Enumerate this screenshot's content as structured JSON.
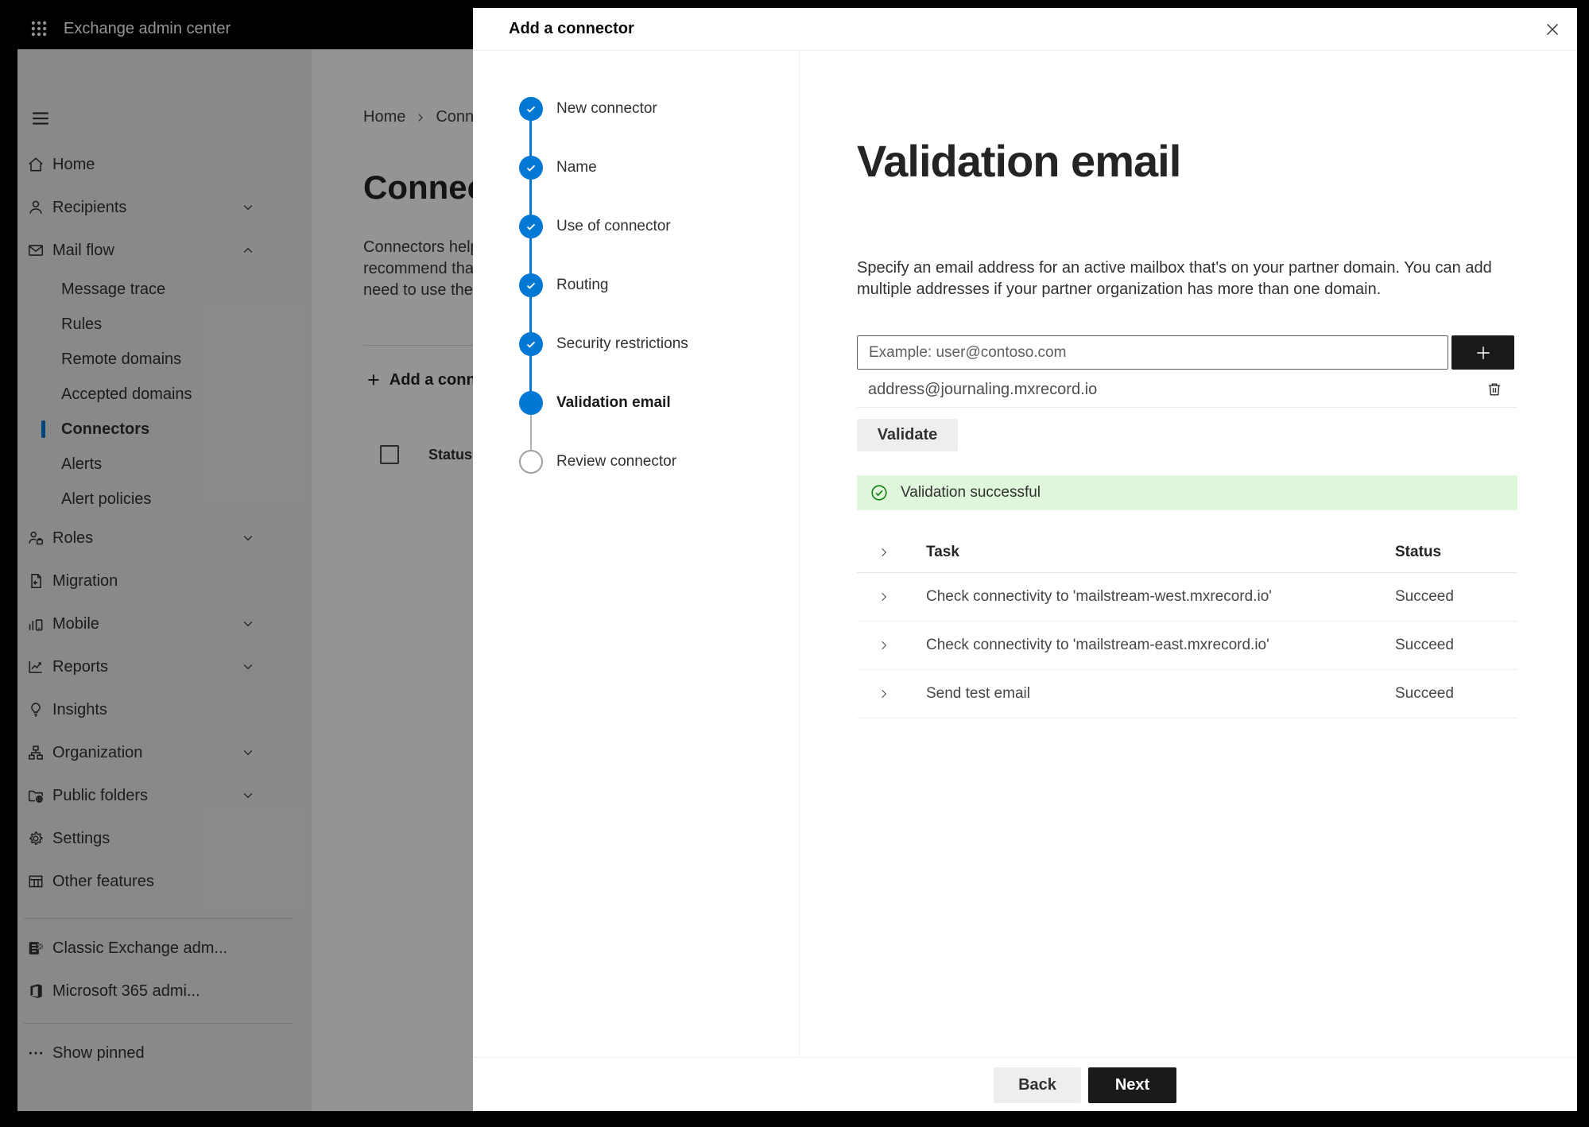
{
  "topbar": {
    "title": "Exchange admin center"
  },
  "sidebar": {
    "items": [
      {
        "label": "Home"
      },
      {
        "label": "Recipients"
      },
      {
        "label": "Mail flow"
      },
      {
        "label": "Message trace"
      },
      {
        "label": "Rules"
      },
      {
        "label": "Remote domains"
      },
      {
        "label": "Accepted domains"
      },
      {
        "label": "Connectors"
      },
      {
        "label": "Alerts"
      },
      {
        "label": "Alert policies"
      },
      {
        "label": "Roles"
      },
      {
        "label": "Migration"
      },
      {
        "label": "Mobile"
      },
      {
        "label": "Reports"
      },
      {
        "label": "Insights"
      },
      {
        "label": "Organization"
      },
      {
        "label": "Public folders"
      },
      {
        "label": "Settings"
      },
      {
        "label": "Other features"
      },
      {
        "label": "Classic Exchange adm..."
      },
      {
        "label": "Microsoft 365 admi..."
      },
      {
        "label": "Show pinned"
      }
    ]
  },
  "page": {
    "breadcrumb_home": "Home",
    "breadcrumb_current": "Conne",
    "title": "Connec",
    "description": "Connectors help\nrecommend tha\nneed to use ther",
    "add_button": "Add a conn",
    "status_header": "Status"
  },
  "dialog": {
    "title": "Add a connector",
    "steps": [
      {
        "label": "New connector",
        "state": "done"
      },
      {
        "label": "Name",
        "state": "done"
      },
      {
        "label": "Use of connector",
        "state": "done"
      },
      {
        "label": "Routing",
        "state": "done"
      },
      {
        "label": "Security restrictions",
        "state": "done"
      },
      {
        "label": "Validation email",
        "state": "current"
      },
      {
        "label": "Review connector",
        "state": "todo"
      }
    ],
    "content": {
      "heading": "Validation email",
      "description": "Specify an email address for an active mailbox that's on your partner domain. You can add multiple addresses if your partner organization has more than one domain.",
      "email_placeholder": "Example: user@contoso.com",
      "added_address": "address@journaling.mxrecord.io",
      "validate_button": "Validate",
      "success_message": "Validation successful",
      "table": {
        "columns": [
          "Task",
          "Status"
        ],
        "rows": [
          {
            "task": "Check connectivity to 'mailstream-west.mxrecord.io'",
            "status": "Succeed"
          },
          {
            "task": "Check connectivity to 'mailstream-east.mxrecord.io'",
            "status": "Succeed"
          },
          {
            "task": "Send test email",
            "status": "Succeed"
          }
        ]
      }
    },
    "footer": {
      "back": "Back",
      "next": "Next"
    }
  },
  "colors": {
    "accent": "#0078d4",
    "success_bg": "#dff6dd",
    "success_icon": "#107c10",
    "topbar_bg": "#000000",
    "primary_button_bg": "#1b1a19"
  }
}
